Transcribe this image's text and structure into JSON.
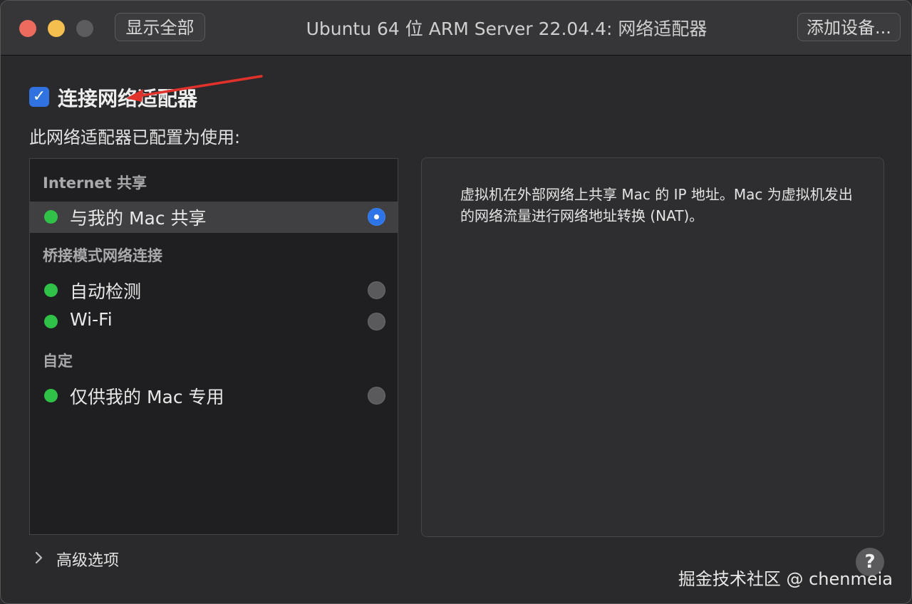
{
  "window": {
    "title": "Ubuntu 64 位 ARM Server 22.04.4: 网络适配器",
    "show_all_label": "显示全部",
    "add_device_label": "添加设备..."
  },
  "connect": {
    "checked": true,
    "label": "连接网络适配器"
  },
  "configured_label": "此网络适配器已配置为使用:",
  "sections": [
    {
      "header": "Internet 共享",
      "items": [
        {
          "label": "与我的 Mac 共享",
          "status": "green",
          "selected": true
        }
      ]
    },
    {
      "header": "桥接模式网络连接",
      "items": [
        {
          "label": "自动检测",
          "status": "green",
          "selected": false
        },
        {
          "label": "Wi-Fi",
          "status": "green",
          "selected": false
        }
      ]
    },
    {
      "header": "自定",
      "items": [
        {
          "label": "仅供我的 Mac 专用",
          "status": "green",
          "selected": false
        }
      ]
    }
  ],
  "description": "虚拟机在外部网络上共享 Mac 的 IP 地址。Mac 为虚拟机发出的网络流量进行网络地址转换 (NAT)。",
  "advanced_label": "高级选项",
  "help_label": "?",
  "watermark": "掘金技术社区 @ chenmeia",
  "colors": {
    "accent": "#2c74e8",
    "status_green": "#30c148",
    "annotation_arrow": "#e0312b"
  }
}
